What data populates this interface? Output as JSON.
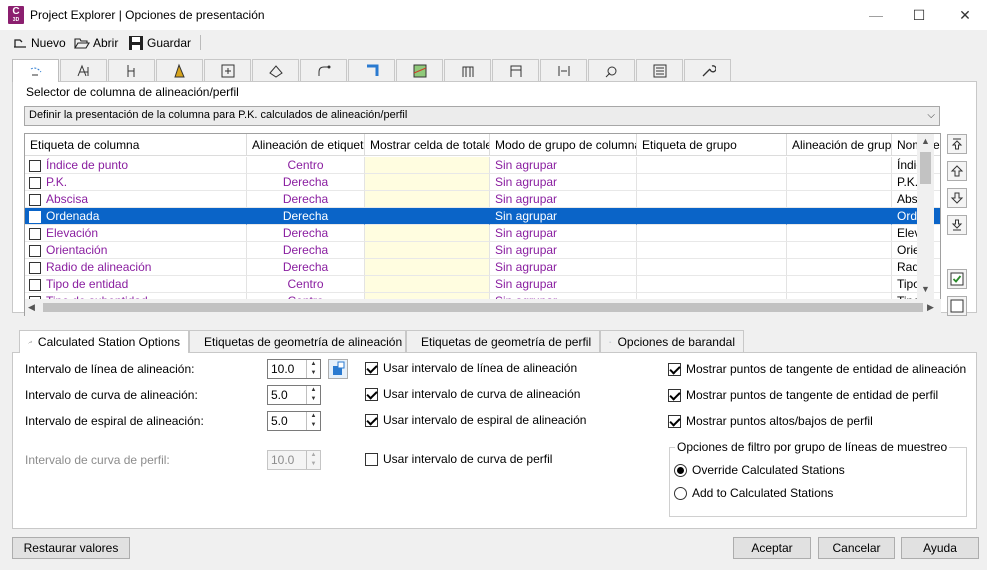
{
  "window": {
    "title": "Project Explorer | Opciones de presentación",
    "icon_letter": "C",
    "icon_sub": "3D",
    "minimize": "—",
    "maximize": "☐",
    "close": "✕"
  },
  "toolbar": {
    "new_label": "Nuevo",
    "open_label": "Abrir",
    "save_label": "Guardar"
  },
  "icon_tabs": [
    "label-stations-icon",
    "alignment-icon",
    "profile-icon",
    "corridor-icon",
    "assembly-icon",
    "surface-icon",
    "pipe-network-icon",
    "pressure-network-icon",
    "sample-lines-icon",
    "structure-icon",
    "part-icon",
    "section-icon",
    "points-icon",
    "list-icon",
    "settings-icon"
  ],
  "selector": {
    "label": "Selector de columna de alineación/perfil",
    "value": "Definir la presentación de la columna para P.K. calculados de alineación/perfil"
  },
  "grid": {
    "headers": [
      "Etiqueta de columna",
      "Alineación de etiqueta",
      "Mostrar celda de totales",
      "Modo de grupo de columnas",
      "Etiqueta de grupo",
      "Alineación de grupo",
      "Nombre"
    ],
    "rows": [
      {
        "label": "Índice de punto",
        "align": "Centro",
        "mode": "Sin agrupar",
        "name": "Índice"
      },
      {
        "label": "P.K.",
        "align": "Derecha",
        "mode": "Sin agrupar",
        "name": "P.K."
      },
      {
        "label": "Abscisa",
        "align": "Derecha",
        "mode": "Sin agrupar",
        "name": "Absci"
      },
      {
        "label": "Ordenada",
        "align": "Derecha",
        "mode": "Sin agrupar",
        "name": "Orden"
      },
      {
        "label": "Elevación",
        "align": "Derecha",
        "mode": "Sin agrupar",
        "name": "Eleva"
      },
      {
        "label": "Orientación",
        "align": "Derecha",
        "mode": "Sin agrupar",
        "name": "Orien"
      },
      {
        "label": "Radio de alineación",
        "align": "Derecha",
        "mode": "Sin agrupar",
        "name": "Radio"
      },
      {
        "label": "Tipo de entidad",
        "align": "Centro",
        "mode": "Sin agrupar",
        "name": "Tipo d"
      },
      {
        "label": "Tipo de subentidad",
        "align": "Centro",
        "mode": "Sin agrupar",
        "name": "Tipo"
      }
    ],
    "selected_index": 3
  },
  "lower_tabs": [
    {
      "label": "Calculated Station Options",
      "icon": "wrench-icon"
    },
    {
      "label": "Etiquetas de geometría de alineación",
      "icon": "alignment-label-icon"
    },
    {
      "label": "Etiquetas de geometría de perfil",
      "icon": "profile-label-icon"
    },
    {
      "label": "Opciones de barandal",
      "icon": "railing-icon"
    }
  ],
  "options": {
    "align_interval_label": "Intervalo de línea de alineación:",
    "align_interval_value": "10.0",
    "curve_interval_label": "Intervalo de curva de alineación:",
    "curve_interval_value": "5.0",
    "spiral_interval_label": "Intervalo de espiral de alineación:",
    "spiral_interval_value": "5.0",
    "profile_curve_label": "Intervalo de curva de perfil:",
    "profile_curve_value": "10.0",
    "use_line_interval": "Usar intervalo de línea de alineación",
    "use_curve_interval": "Usar intervalo de curva de alineación",
    "use_spiral_interval": "Usar intervalo de espiral de alineación",
    "use_profile_curve_interval": "Usar intervalo de curva de perfil",
    "show_align_tangent": "Mostrar puntos de tangente de entidad de alineación",
    "show_profile_tangent": "Mostrar puntos de tangente de entidad de perfil",
    "show_high_low": "Mostrar puntos altos/bajos de perfil",
    "filter_group_label": "Opciones de filtro por grupo de líneas de muestreo",
    "override_label": "Override Calculated Stations",
    "add_label": "Add to Calculated Stations"
  },
  "buttons": {
    "restore": "Restaurar valores",
    "accept": "Aceptar",
    "cancel": "Cancelar",
    "help": "Ayuda"
  }
}
